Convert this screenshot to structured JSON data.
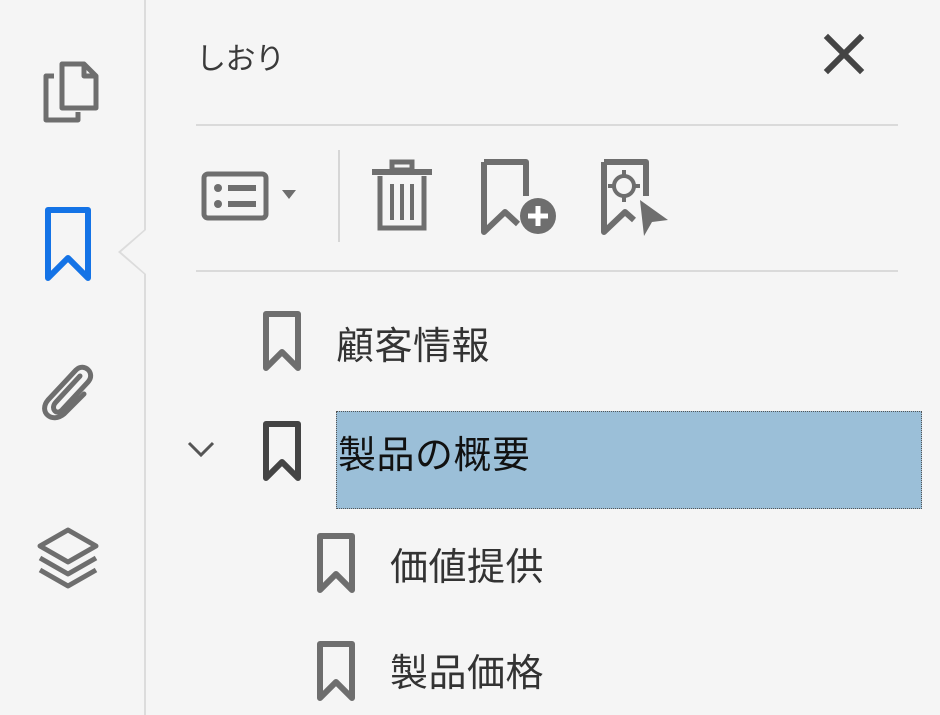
{
  "nav_rail": {
    "items": [
      {
        "name": "pages",
        "icon": "pages-icon",
        "active": false
      },
      {
        "name": "bookmarks",
        "icon": "bookmark-icon",
        "active": true
      },
      {
        "name": "attachments",
        "icon": "paperclip-icon",
        "active": false
      },
      {
        "name": "layers",
        "icon": "layers-icon",
        "active": false
      }
    ],
    "active_color": "#1473e6",
    "icon_color": "#6e6e6e"
  },
  "panel": {
    "title": "しおり",
    "close_icon": "close-icon"
  },
  "toolbar": {
    "options_icon": "options-menu-icon",
    "delete_icon": "trash-icon",
    "new_bookmark_icon": "new-bookmark-icon",
    "bookmark_from_selection_icon": "bookmark-target-icon"
  },
  "bookmarks": [
    {
      "label": "顧客情報",
      "level": 0,
      "expanded": null,
      "selected": false
    },
    {
      "label": "製品の概要",
      "level": 0,
      "expanded": true,
      "selected": true
    },
    {
      "label": "価値提供",
      "level": 1,
      "expanded": null,
      "selected": false
    },
    {
      "label": "製品価格",
      "level": 1,
      "expanded": null,
      "selected": false
    }
  ],
  "selection_color": "#9bbfd8"
}
